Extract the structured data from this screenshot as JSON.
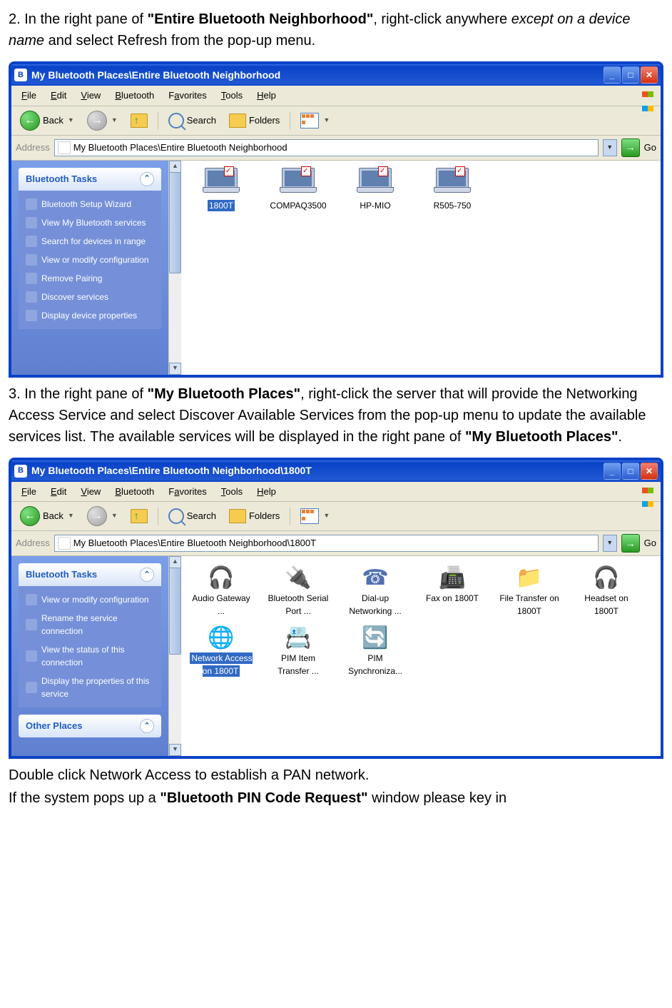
{
  "step2": {
    "prefix": "2. In the right pane of ",
    "bold": "\"Entire Bluetooth Neighborhood\"",
    "mid": ", right-click anywhere ",
    "italic": "except on a device name",
    "suffix": " and select Refresh from the pop-up menu."
  },
  "step3": {
    "prefix": "3. In the right pane of ",
    "bold1": "\"My Bluetooth Places\"",
    "mid": ", right-click the server that will provide the Networking Access Service and select Discover Available Services from the pop-up menu to update the available services list. The available services will be displayed in the right pane of ",
    "bold2": "\"My Bluetooth Places\"",
    "suffix": "."
  },
  "footer1": "Double click Network Access to establish a PAN network.",
  "footer2_a": "If the system pops up a ",
  "footer2_b": "\"Bluetooth PIN Code Request\"",
  "footer2_c": " window please key in",
  "win1": {
    "title": "My Bluetooth Places\\Entire Bluetooth Neighborhood",
    "address": "My Bluetooth Places\\Entire Bluetooth Neighborhood",
    "tasks_header": "Bluetooth Tasks",
    "tasks": [
      "Bluetooth Setup Wizard",
      "View My Bluetooth services",
      "Search for devices in range",
      "View or modify configuration",
      "Remove Pairing",
      "Discover services",
      "Display device properties"
    ],
    "devices": [
      "1800T",
      "COMPAQ3500",
      "HP-MIO",
      "R505-750"
    ]
  },
  "win2": {
    "title": "My Bluetooth Places\\Entire Bluetooth Neighborhood\\1800T",
    "address": "My Bluetooth Places\\Entire Bluetooth Neighborhood\\1800T",
    "tasks_header": "Bluetooth Tasks",
    "other_header": "Other Places",
    "tasks": [
      "View or modify configuration",
      "Rename the service connection",
      "View the status of this connection",
      "Display the properties of this service"
    ],
    "services": [
      "Audio Gateway ...",
      "Bluetooth Serial Port ...",
      "Dial-up Networking ...",
      "Fax on 1800T",
      "File Transfer on 1800T",
      "Headset on 1800T",
      "Network Access on 1800T",
      "PIM Item Transfer ...",
      "PIM Synchroniza..."
    ]
  },
  "menus": [
    "File",
    "Edit",
    "View",
    "Bluetooth",
    "Favorites",
    "Tools",
    "Help"
  ],
  "toolbar": {
    "back": "Back",
    "search": "Search",
    "folders": "Folders"
  },
  "address_label": "Address",
  "go_label": "Go"
}
